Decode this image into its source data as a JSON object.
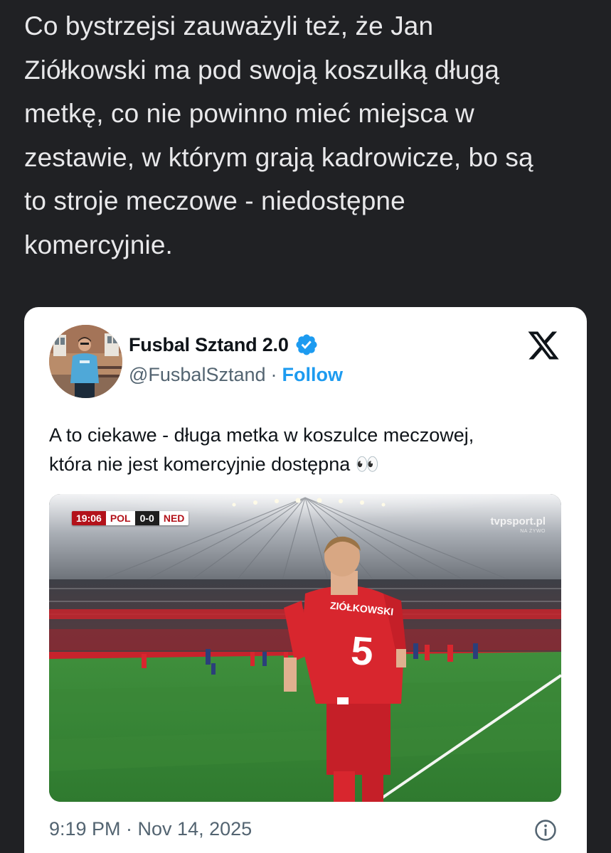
{
  "article": {
    "paragraph": "Co bystrzejsi zauważyli też, że Jan\nZiółkowski ma pod swoją koszulką długą\nmetkę, co nie powinno mieć miejsca w\nzestawie, w którym grają kadrowicze, bo są\nto stroje meczowe - niedostępne\nkomercyjnie."
  },
  "tweet": {
    "author_name": "Fusbal Sztand 2.0",
    "handle": "@FusbalSztand",
    "separator": "·",
    "follow_label": "Follow",
    "text": "A to ciekawe - długa metka w koszulce meczowej,\nktóra nie jest komercyjnie dostępna 👀",
    "timestamp": "9:19 PM · Nov 14, 2025",
    "media": {
      "score_bug": {
        "clock": "19:06",
        "home": "POL",
        "score": "0-0",
        "away": "NED"
      },
      "broadcaster": "tvpsport.pl",
      "broadcaster_sub": "NA ŻYWO",
      "shirt_name": "ZIÓŁKOWSKI",
      "shirt_number": "5"
    }
  },
  "colors": {
    "page_bg": "#202124",
    "article_text": "#e8e8ea",
    "card_bg": "#ffffff",
    "name_text": "#0f1419",
    "muted_text": "#536471",
    "accent_blue": "#1d9bf0",
    "kit_red": "#d8262e"
  },
  "icons": {
    "verified": "verified-badge-icon",
    "logo": "x-logo-icon",
    "info": "info-icon"
  }
}
